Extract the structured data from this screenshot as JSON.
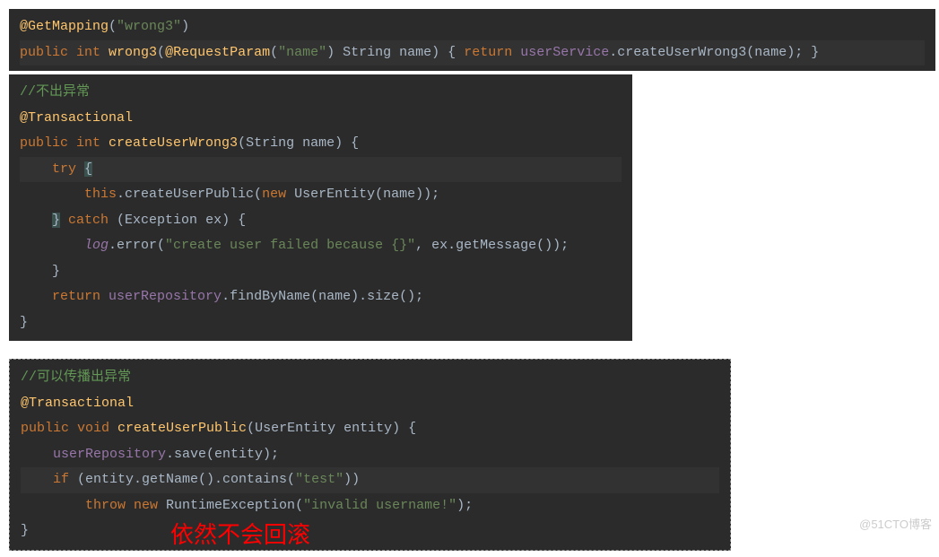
{
  "block1": {
    "line1": {
      "ann": "@GetMapping",
      "str": "\"wrong3\""
    },
    "line2": {
      "kw1": "public int ",
      "method": "wrong3",
      "ann2": "@RequestParam",
      "str2": "\"name\"",
      "type": " String name",
      "kw2": "return ",
      "field": "userService",
      "call": ".createUserWrong3(name); }"
    }
  },
  "block2": {
    "comment": "//不出异常",
    "ann": "@Transactional",
    "kw_public": "public int ",
    "method_def": "createUserWrong3",
    "sig_params": "(String name) {",
    "kw_try": "    try ",
    "brace1": "{",
    "kw_this": "        this",
    "call1": ".createUserPublic(",
    "kw_new": "new ",
    "type_ue": "UserEntity",
    "call1_end": "(name));",
    "brace2": "    }",
    "kw_catch": " catch ",
    "catch_params": "(Exception ex) {",
    "log_field": "        log",
    "log_call": ".error(",
    "log_str": "\"create user failed because {}\"",
    "log_end": ", ex.getMessage());",
    "brace3": "    }",
    "kw_return": "    return ",
    "repo_field": "userRepository",
    "repo_call": ".findByName(name).size();",
    "brace4": "}"
  },
  "block3": {
    "comment": "//可以传播出异常",
    "ann": "@Transactional",
    "kw_public": "public void ",
    "method_def": "createUserPublic",
    "sig_params": "(UserEntity entity) {",
    "repo_field": "    userRepository",
    "repo_call": ".save(entity);",
    "kw_if": "    if ",
    "if_cond_start": "(entity.getName().contains(",
    "if_str": "\"test\"",
    "if_cond_end": "))",
    "kw_throw": "        throw new ",
    "exc_type": "RuntimeException",
    "exc_start": "(",
    "exc_str": "\"invalid username!\"",
    "exc_end": ");",
    "brace": "}"
  },
  "red_annotation": "依然不会回滚",
  "watermark": "@51CTO博客"
}
